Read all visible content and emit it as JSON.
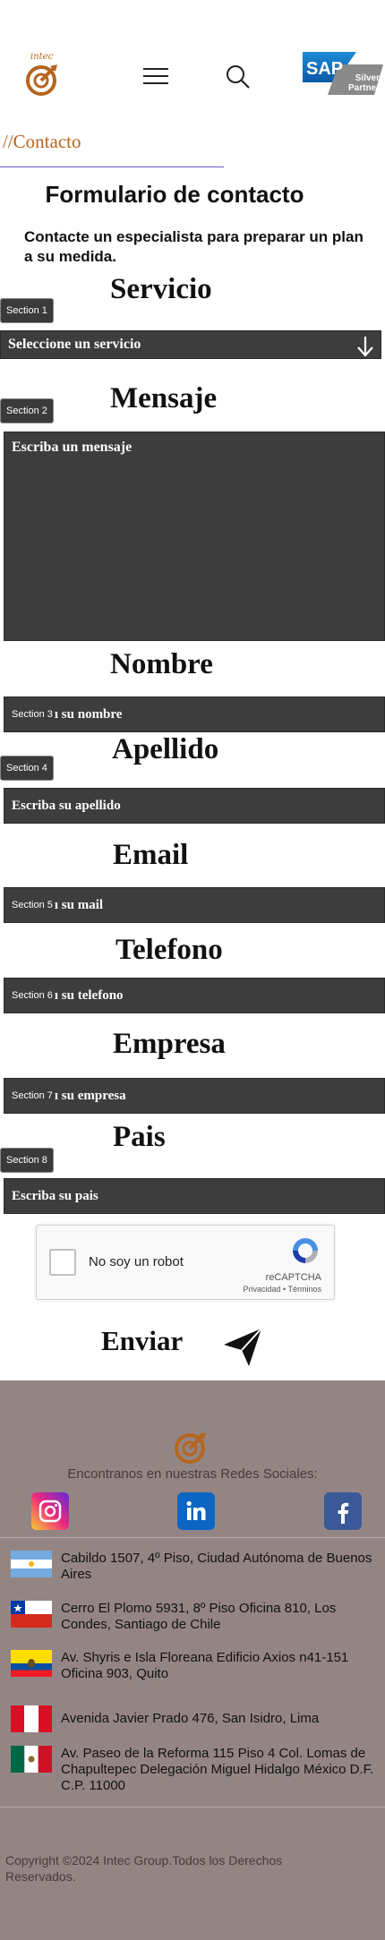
{
  "header": {
    "logo_text": "intec",
    "sap_brand": "SAP",
    "sap_badge_line1": "Silver",
    "sap_badge_line2": "Partner"
  },
  "breadcrumb": "//Contacto",
  "form": {
    "title": "Formulario de contacto",
    "subtitle": "Contacte un especialista para preparar un plan a su medida.",
    "fields": {
      "servicio": {
        "label": "Servicio",
        "placeholder": "Seleccione un servicio",
        "section": "Section 1"
      },
      "mensaje": {
        "label": "Mensaje",
        "placeholder": "Escriba un mensaje",
        "section": "Section 2"
      },
      "nombre": {
        "label": "Nombre",
        "placeholder": "ı su nombre",
        "section": "Section 3"
      },
      "apellido": {
        "label": "Apellido",
        "placeholder": "Escriba su apellido",
        "section": "Section 4"
      },
      "email": {
        "label": "Email",
        "placeholder": "ı su mail",
        "section": "Section 5"
      },
      "telefono": {
        "label": "Telefono",
        "placeholder": "ı su telefono",
        "section": "Section 6"
      },
      "empresa": {
        "label": "Empresa",
        "placeholder": "ı su empresa",
        "section": "Section 7"
      },
      "pais": {
        "label": "Pais",
        "placeholder": "Escriba su pais",
        "section": "Section 8"
      }
    },
    "captcha": {
      "label": "No soy un robot",
      "brand": "reCAPTCHA",
      "links": "Privacidad • Términos"
    },
    "submit_label": "Enviar"
  },
  "footer": {
    "social_title": "Encontranos en nuestras Redes Sociales:",
    "offices": [
      {
        "country": "argentina",
        "address": "Cabildo 1507, 4º Piso, Ciudad Autónoma de Buenos Aires"
      },
      {
        "country": "chile",
        "address": "Cerro El Plomo 5931, 8º Piso Oficina 810, Los Condes, Santiago de Chile"
      },
      {
        "country": "ecuador",
        "address": "Av. Shyris e Isla Floreana Edificio Axios n41-151 Oficina 903, Quito"
      },
      {
        "country": "peru",
        "address": "Avenida Javier Prado 476, San Isidro, Lima"
      },
      {
        "country": "mexico",
        "address": "Av. Paseo de la Reforma 115 Piso 4 Col. Lomas de Chapultepec Delegación Miguel Hidalgo México D.F. C.P. 11000"
      }
    ],
    "copyright": "Copyright ©2024 Intec Group.Todos los Derechos Reservados."
  },
  "colors": {
    "accent": "#b5651d",
    "field_bg": "#3d3d3d",
    "footer_bg": "#948585"
  }
}
